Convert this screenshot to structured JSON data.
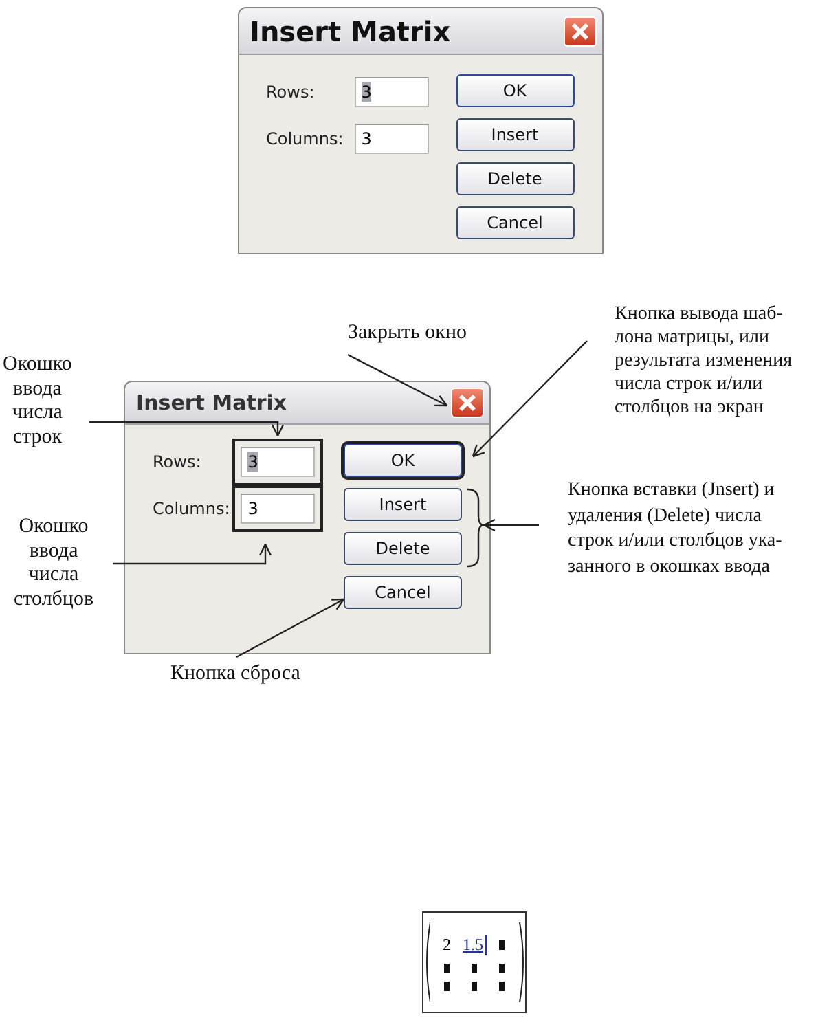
{
  "dialogs": [
    {
      "title": "Insert Matrix",
      "fields": [
        {
          "label": "Rows:",
          "value": "3",
          "selected": true,
          "framed": false
        },
        {
          "label": "Columns:",
          "value": "3",
          "selected": false,
          "framed": false
        }
      ],
      "buttons": [
        {
          "label": "OK",
          "default": true,
          "framed": false
        },
        {
          "label": "Insert",
          "default": false,
          "framed": false
        },
        {
          "label": "Delete",
          "default": false,
          "framed": false
        },
        {
          "label": "Cancel",
          "default": false,
          "framed": false
        }
      ]
    },
    {
      "title": "Insert Matrix",
      "fields": [
        {
          "label": "Rows:",
          "value": "3",
          "selected": true,
          "framed": true
        },
        {
          "label": "Columns:",
          "value": "3",
          "selected": false,
          "framed": true
        }
      ],
      "buttons": [
        {
          "label": "OK",
          "default": true,
          "framed": true
        },
        {
          "label": "Insert",
          "default": false,
          "framed": false
        },
        {
          "label": "Delete",
          "default": false,
          "framed": false
        },
        {
          "label": "Cancel",
          "default": false,
          "framed": false
        }
      ]
    }
  ],
  "annotations": {
    "close_window": "Закрыть окно",
    "rows_field": "Окошко\nввода\nчисла\nстрок",
    "columns_field": "Окошко\nввода\nчисла\nстолбцов",
    "reset_button": "Кнопка сброса",
    "ok_button": "Кнопка вывода шаб-\nлона матрицы, или\nрезультата изменения\nчисла строк и/или\nстолбцов на экран",
    "insert_delete": "Кнопка вставки (Jnsert) и\nудаления (Delete) числа\nстрок и/или столбцов ука-\nзанного в окошках ввода"
  },
  "matrix": {
    "rows": [
      [
        {
          "kind": "value",
          "text": "2",
          "selected": false
        },
        {
          "kind": "value",
          "text": "1.5",
          "selected": true
        },
        {
          "kind": "placeholder"
        }
      ],
      [
        {
          "kind": "placeholder"
        },
        {
          "kind": "placeholder"
        },
        {
          "kind": "placeholder"
        }
      ],
      [
        {
          "kind": "placeholder"
        },
        {
          "kind": "placeholder"
        },
        {
          "kind": "placeholder"
        }
      ]
    ]
  }
}
